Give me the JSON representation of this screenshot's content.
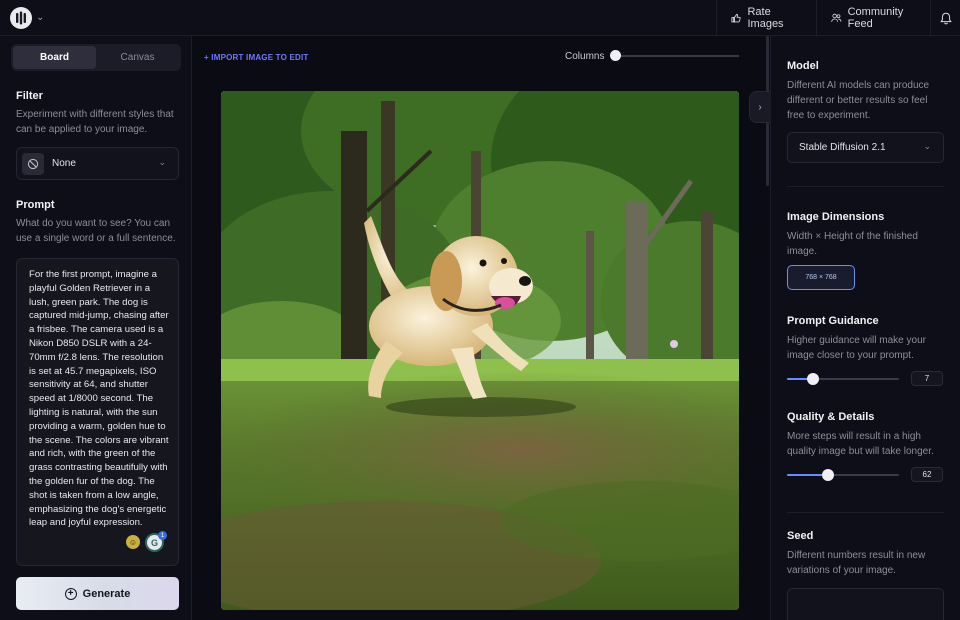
{
  "topbar": {
    "rate_label": "Rate Images",
    "feed_label": "Community Feed"
  },
  "left": {
    "tabs": [
      {
        "label": "Board",
        "active": true
      },
      {
        "label": "Canvas",
        "active": false
      }
    ],
    "filter": {
      "title": "Filter",
      "description": "Experiment with different styles that can be applied to your image.",
      "value": "None"
    },
    "prompt": {
      "title": "Prompt",
      "description": "What do you want to see? You can use a single word or a full sentence.",
      "text": "For the first prompt, imagine a playful Golden Retriever in a lush, green park. The dog is captured mid-jump, chasing after a frisbee. The camera used is a Nikon D850 DSLR with a 24-70mm f/2.8 lens. The resolution is set at 45.7 megapixels, ISO sensitivity at 64, and shutter speed at 1/8000 second. The lighting is natural, with the sun providing a warm, golden hue to the scene. The colors are vibrant and rich, with the green of the grass contrasting beautifully with the golden fur of the dog. The shot is taken from a low angle, emphasizing the dog's energetic leap and joyful expression.",
      "badge_count": "1"
    },
    "generate_label": "Generate"
  },
  "center": {
    "import_label": "+ IMPORT IMAGE TO EDIT",
    "columns_label": "Columns",
    "columns_value": 1
  },
  "right": {
    "model": {
      "title": "Model",
      "description": "Different AI models can produce different or better results so feel free to experiment.",
      "value": "Stable Diffusion 2.1"
    },
    "dimensions": {
      "title": "Image Dimensions",
      "description": "Width × Height of the finished image.",
      "value": "768 × 768"
    },
    "guidance": {
      "title": "Prompt Guidance",
      "description": "Higher guidance will make your image closer to your prompt.",
      "value": "7",
      "fraction": 0.23
    },
    "quality": {
      "title": "Quality & Details",
      "description": "More steps will result in a high quality image but will take longer.",
      "value": "62",
      "fraction": 0.37
    },
    "seed": {
      "title": "Seed",
      "description": "Different numbers result in new variations of your image."
    }
  },
  "colors": {
    "background": "#0b0b14",
    "panel": "#0e0e18",
    "accent": "#6c8bff",
    "import_link": "#6f78ff"
  }
}
